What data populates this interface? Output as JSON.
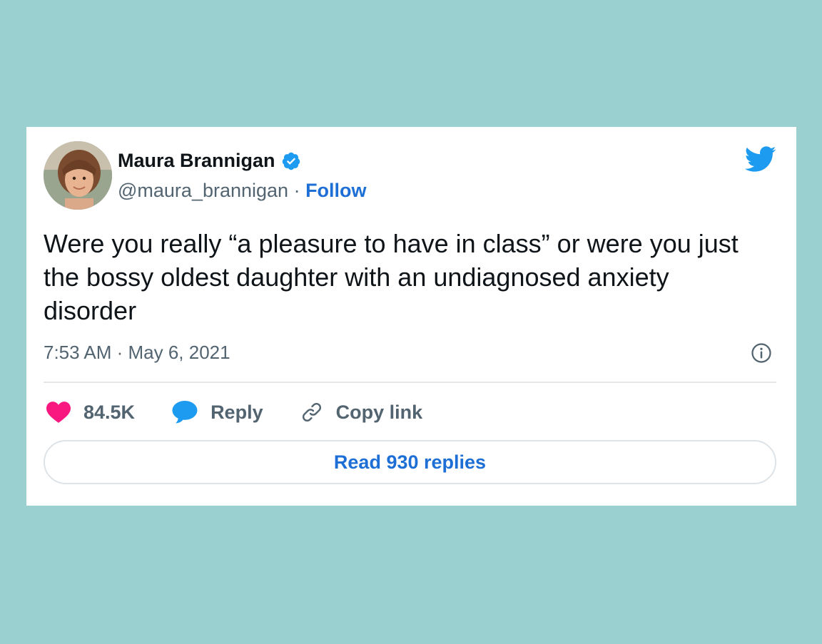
{
  "tweet": {
    "author_name": "Maura Brannigan",
    "handle": "@maura_brannigan",
    "separator": " · ",
    "follow_label": "Follow",
    "text": "Were you really “a pleasure to have in class” or were you just the bossy oldest daughter with an undiagnosed anxiety disorder",
    "timestamp": "7:53 AM · May 6, 2021"
  },
  "actions": {
    "likes_count": "84.5K",
    "reply_label": "Reply",
    "copy_link_label": "Copy link"
  },
  "read_replies_label": "Read 930 replies",
  "icons": {
    "verified": "verified-badge-icon",
    "brand": "twitter-bird-icon",
    "info": "info-icon",
    "like": "heart-icon",
    "reply": "speech-bubble-icon",
    "copy_link": "link-icon"
  },
  "colors": {
    "page_background": "#9bd0d1",
    "card_background": "#ffffff",
    "twitter_blue": "#1d9bf0",
    "link_blue": "#1d6fd6",
    "like_pink": "#f91880",
    "text_primary": "#0f1419",
    "text_secondary": "#536471"
  }
}
